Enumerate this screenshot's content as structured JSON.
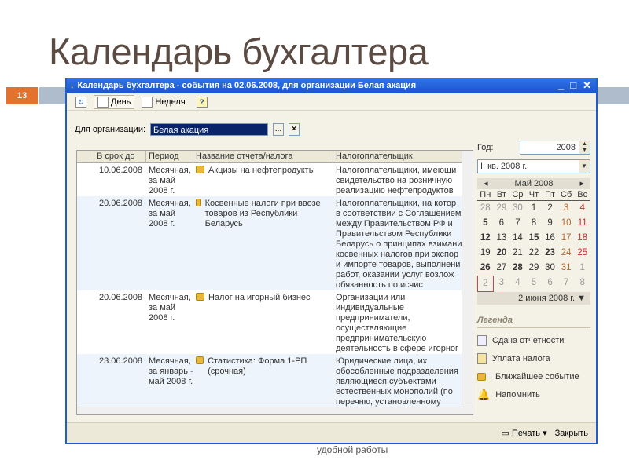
{
  "slide": {
    "title": "Календарь бухгалтера",
    "number": "13",
    "caption": "удобной работы"
  },
  "window": {
    "title": "Календарь бухгалтера - события на 02.06.2008, для организации Белая акация"
  },
  "toolbar": {
    "day": "День",
    "week": "Неделя",
    "help": "?"
  },
  "org": {
    "label": "Для организации:",
    "value": "Белая акация",
    "select": "...",
    "clear": "×"
  },
  "table": {
    "headers": [
      "В срок до",
      "Период",
      "Название отчета/налога",
      "Налогоплательщик"
    ],
    "rows": [
      {
        "date": "10.06.2008",
        "period": "Месячная, за май 2008 г.",
        "name": "Акцизы на нефтепродукты",
        "payer": [
          "Налогоплательщики, имеющи",
          "свидетельство на розничную",
          "реализацию нефтепродуктов"
        ]
      },
      {
        "date": "20.06.2008",
        "period": "Месячная, за май 2008 г.",
        "name": "Косвенные налоги при ввозе товаров из Республики Беларусь",
        "payer": [
          "Налогоплательщики, на котор",
          "в соответствии с Соглашением",
          "между Правительством РФ и",
          "Правительством Республики",
          "Беларусь о принципах взимани",
          "косвенных налогов при экспор",
          "и импорте товаров, выполнени",
          "работ, оказании услуг возлож",
          "обязанность по исчис"
        ]
      },
      {
        "date": "20.06.2008",
        "period": "Месячная, за май 2008 г.",
        "name": "Налог на игорный бизнес",
        "payer": [
          "Организации или",
          "индивидуальные",
          "предприниматели,",
          "осуществляющие",
          "предпринимательскую",
          "деятельность в сфере игорног"
        ]
      },
      {
        "date": "23.06.2008",
        "period": "Месячная, за январь - май 2008 г.",
        "name": "Статистика: Форма 1-РП (срочная)",
        "payer": [
          "Юридические лица, их",
          "обособленные подразделения",
          "являющиеся субъектами",
          "естественных монополий (по",
          "перечню, установленному"
        ]
      }
    ]
  },
  "right": {
    "year_label": "Год:",
    "year": "2008",
    "quarter": "II кв. 2008 г.",
    "month": "Май 2008",
    "dows": [
      "Пн",
      "Вт",
      "Ср",
      "Чт",
      "Пт",
      "Сб",
      "Вс"
    ],
    "weeks": [
      [
        "28",
        "29",
        "30",
        "1",
        "2",
        "3",
        "4"
      ],
      [
        "5",
        "6",
        "7",
        "8",
        "9",
        "10",
        "11"
      ],
      [
        "12",
        "13",
        "14",
        "15",
        "16",
        "17",
        "18"
      ],
      [
        "19",
        "20",
        "21",
        "22",
        "23",
        "24",
        "25"
      ],
      [
        "26",
        "27",
        "28",
        "29",
        "30",
        "31",
        "1"
      ],
      [
        "2",
        "3",
        "4",
        "5",
        "6",
        "7",
        "8"
      ]
    ],
    "date_footer": "2 июня 2008 г.",
    "legend_title": "Легенда",
    "legend": [
      "Сдача отчетности",
      "Уплата налога",
      "Ближайшее событие",
      "Напомнить"
    ]
  },
  "footer": {
    "print": "Печать",
    "close": "Закрыть"
  }
}
